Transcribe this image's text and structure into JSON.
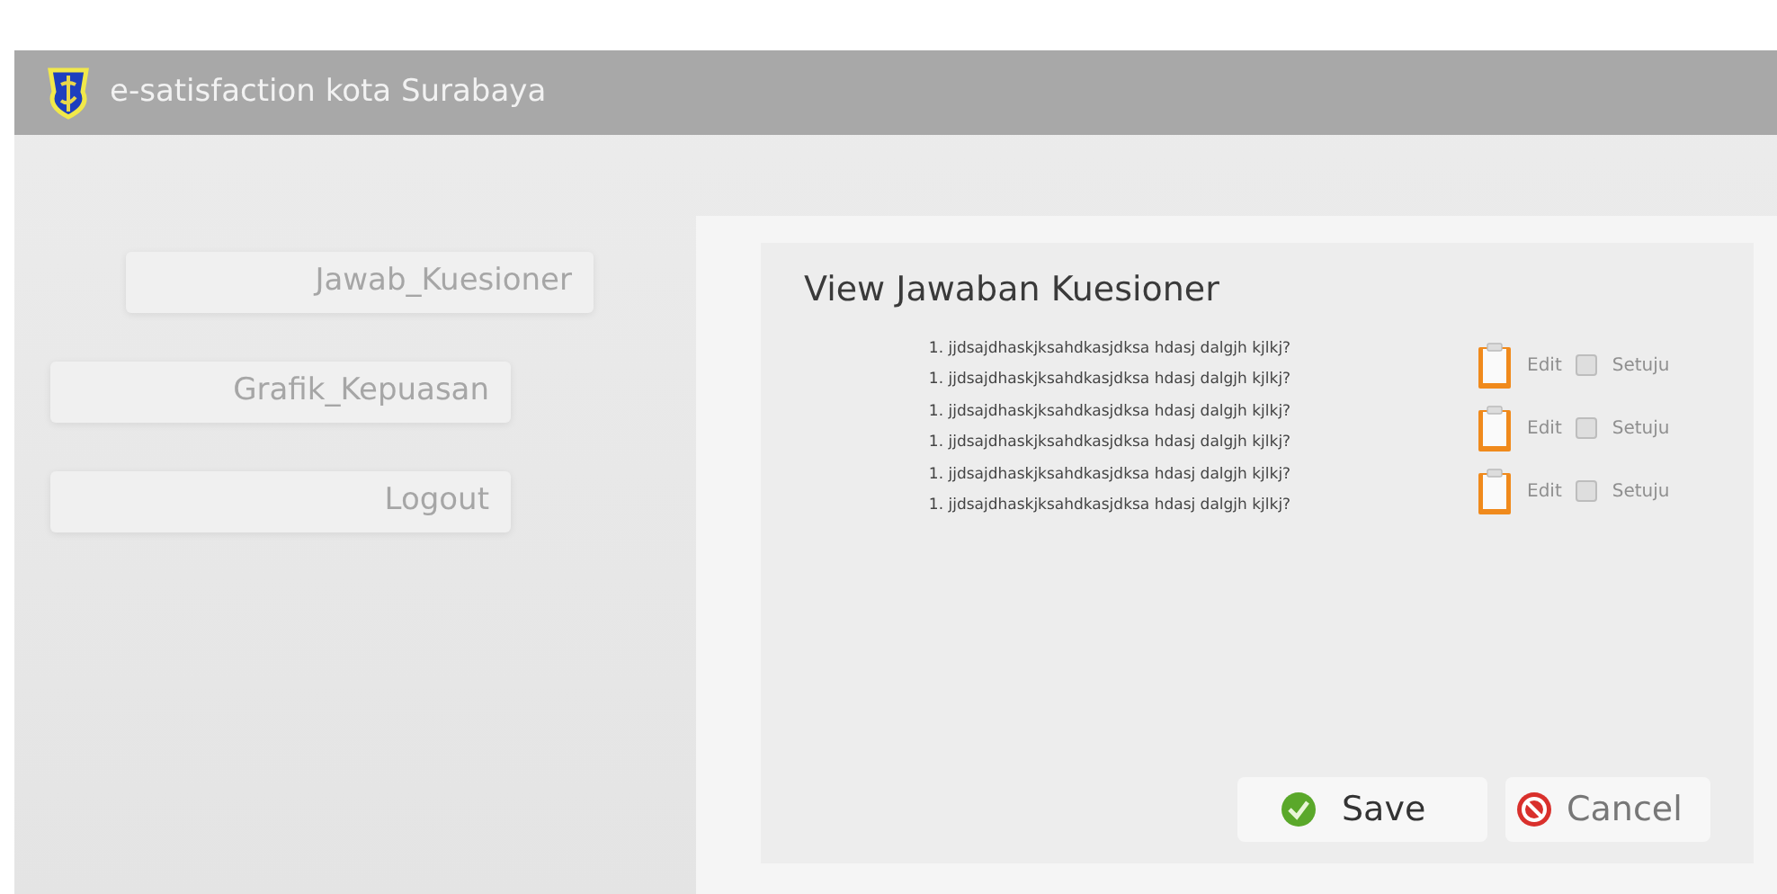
{
  "header": {
    "title": "e-satisfaction kota Surabaya"
  },
  "menu": [
    {
      "label": "Jawab_Kuesioner"
    },
    {
      "label": "Grafik_Kepuasan"
    },
    {
      "label": "Logout"
    }
  ],
  "panel": {
    "title": "View Jawaban Kuesioner",
    "groups": [
      {
        "questions": [
          "1. jjdsajdhaskjksahdkasjdksa hdasj dalgjh kjlkj?",
          "1. jjdsajdhaskjksahdkasjdksa hdasj dalgjh kjlkj?"
        ],
        "edit": "Edit",
        "agree": {
          "label": "Setuju",
          "checked": false
        }
      },
      {
        "questions": [
          "1. jjdsajdhaskjksahdkasjdksa hdasj dalgjh kjlkj?",
          "1. jjdsajdhaskjksahdkasjdksa hdasj dalgjh kjlkj?"
        ],
        "edit": "Edit",
        "agree": {
          "label": "Setuju",
          "checked": false
        }
      },
      {
        "questions": [
          "1. jjdsajdhaskjksahdkasjdksa hdasj dalgjh kjlkj?",
          "1. jjdsajdhaskjksahdkasjdksa hdasj dalgjh kjlkj?"
        ],
        "edit": "Edit",
        "agree": {
          "label": "Setuju",
          "checked": false
        }
      }
    ],
    "buttons": [
      {
        "kind": "save",
        "label": "Save"
      },
      {
        "kind": "cancel",
        "label": "Cancel"
      }
    ]
  }
}
